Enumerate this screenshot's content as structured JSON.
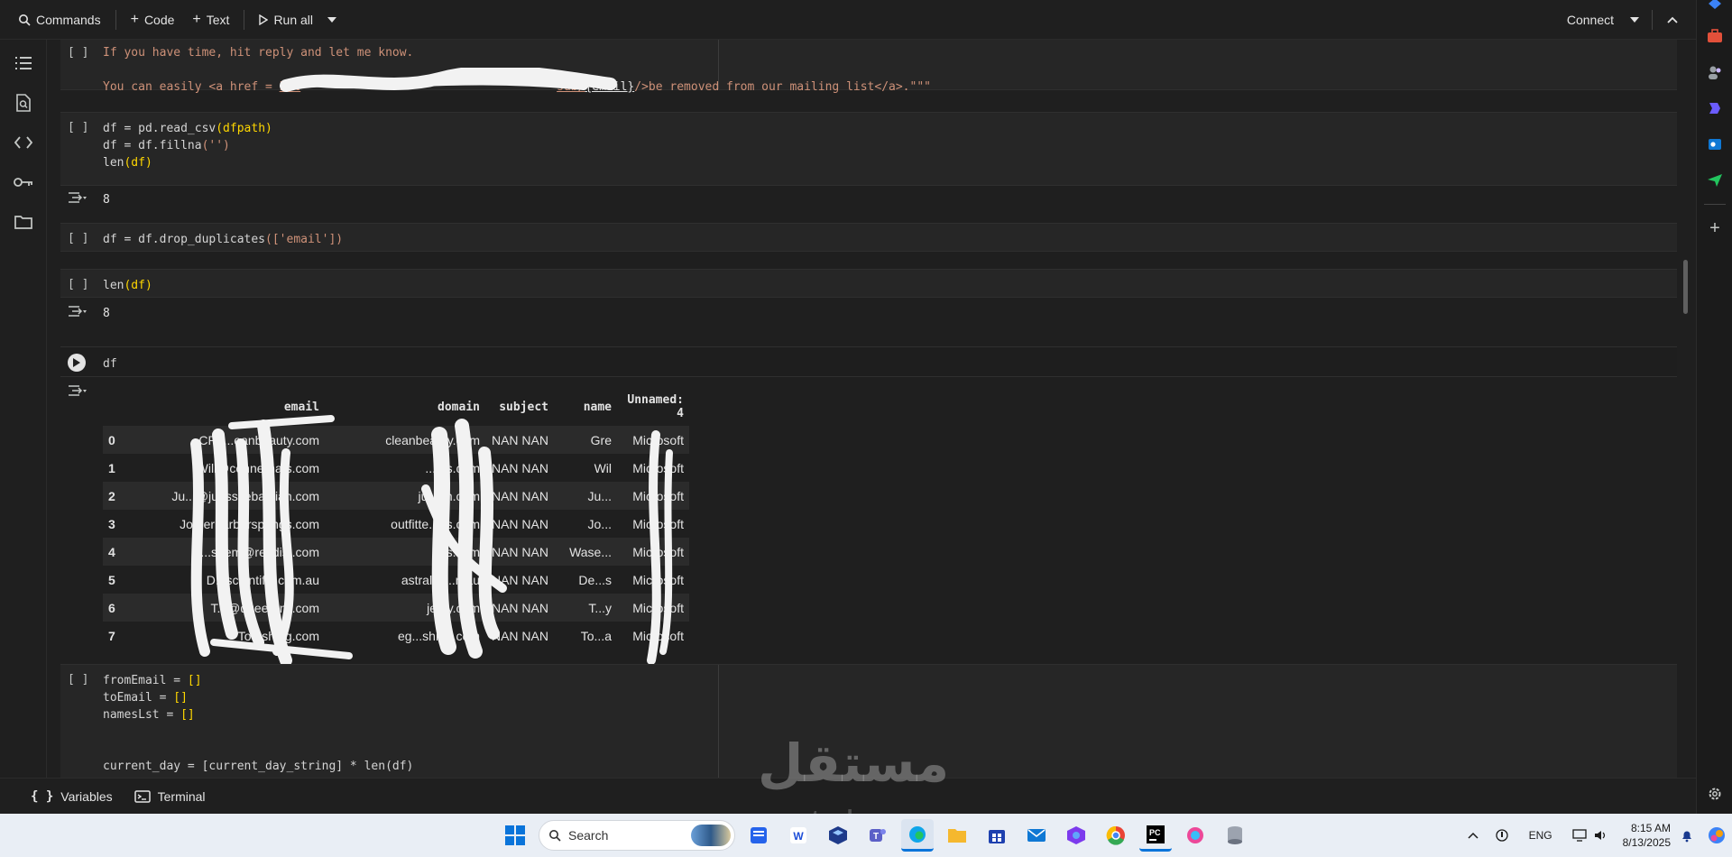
{
  "toolbar": {
    "commands": "Commands",
    "code": "Code",
    "text": "Text",
    "run_all": "Run all",
    "connect": "Connect"
  },
  "cells": {
    "c1": {
      "bracket": "[ ]",
      "line1": "If you have time, hit reply and let me know.",
      "line2_pre": "You can easily <a href = ",
      "line2_link_start": "htt",
      "line2_link_end": "sub/",
      "line2_var": "{email}",
      "line2_post": "/>be removed from our mailing list</a>.\"\"\""
    },
    "c2": {
      "bracket": "[ ]",
      "l1a": "df = pd.read_csv",
      "l1b": "(dfpath)",
      "l2a": "df = df.fillna",
      "l2b": "('')",
      "l3a": "len",
      "l3b": "(df)",
      "output": "8"
    },
    "c3": {
      "bracket": "[ ]",
      "a": "df = df.drop_duplicates",
      "b": "(['email'])"
    },
    "c4": {
      "bracket": "[ ]",
      "a": "len",
      "b": "(df)",
      "output": "8"
    },
    "c5": {
      "code": "df"
    },
    "c6": {
      "bracket": "[ ]",
      "l1a": "fromEmail = ",
      "l1b": "[]",
      "l2a": "toEmail = ",
      "l2b": "[]",
      "l3a": "namesLst = ",
      "l3b": "[]",
      "l4": "current_day = [current_day_string] * len(df)"
    }
  },
  "dataframe": {
    "columns": [
      "",
      "email",
      "domain",
      "subject",
      "name",
      "Unnamed: 4"
    ],
    "rows": [
      [
        "0",
        "CRk...eanbeauty.com",
        "cleanbeauty.com",
        "NAN NAN",
        "Gre",
        "Microsoft"
      ],
      [
        "1",
        "Will@connerhats.com",
        "...ats.com",
        "NAN NAN",
        "Wil",
        "Microsoft"
      ],
      [
        "2",
        "Ju...@juesssebastian.com",
        "ju...an.com",
        "NAN NAN",
        "Ju...",
        "Microsoft"
      ],
      [
        "3",
        "Jo...erharborsprings.com",
        "outfitte...gs.com",
        "NAN NAN",
        "Jo...",
        "Microsoft"
      ],
      [
        "4",
        "...seem@rexdist.com",
        "...s.com",
        "NAN NAN",
        "Wase...",
        "Microsoft"
      ],
      [
        "5",
        "D...scientific.com.au",
        "astralsc...n.au",
        "NAN NAN",
        "De...s",
        "Microsoft"
      ],
      [
        "6",
        "T...@queen-ny.com",
        "je...y.com",
        "NAN NAN",
        "T...y",
        "Microsoft"
      ],
      [
        "7",
        "To...shing.com",
        "eg...shing.com",
        "NAN NAN",
        "To...a",
        "Microsoft"
      ]
    ]
  },
  "bottom": {
    "variables": "Variables",
    "terminal": "Terminal"
  },
  "watermark": {
    "arabic": "مستقل",
    "latin": "mostaql.com"
  },
  "taskbar": {
    "search": "Search",
    "lang": "ENG",
    "time": "8:15 AM",
    "date": "8/13/2025"
  },
  "colors": {
    "background": "#1f1f1f",
    "cell": "#262626",
    "string": "#ce9178",
    "paren": "#ffd700",
    "taskbar": "#e9eef5"
  }
}
